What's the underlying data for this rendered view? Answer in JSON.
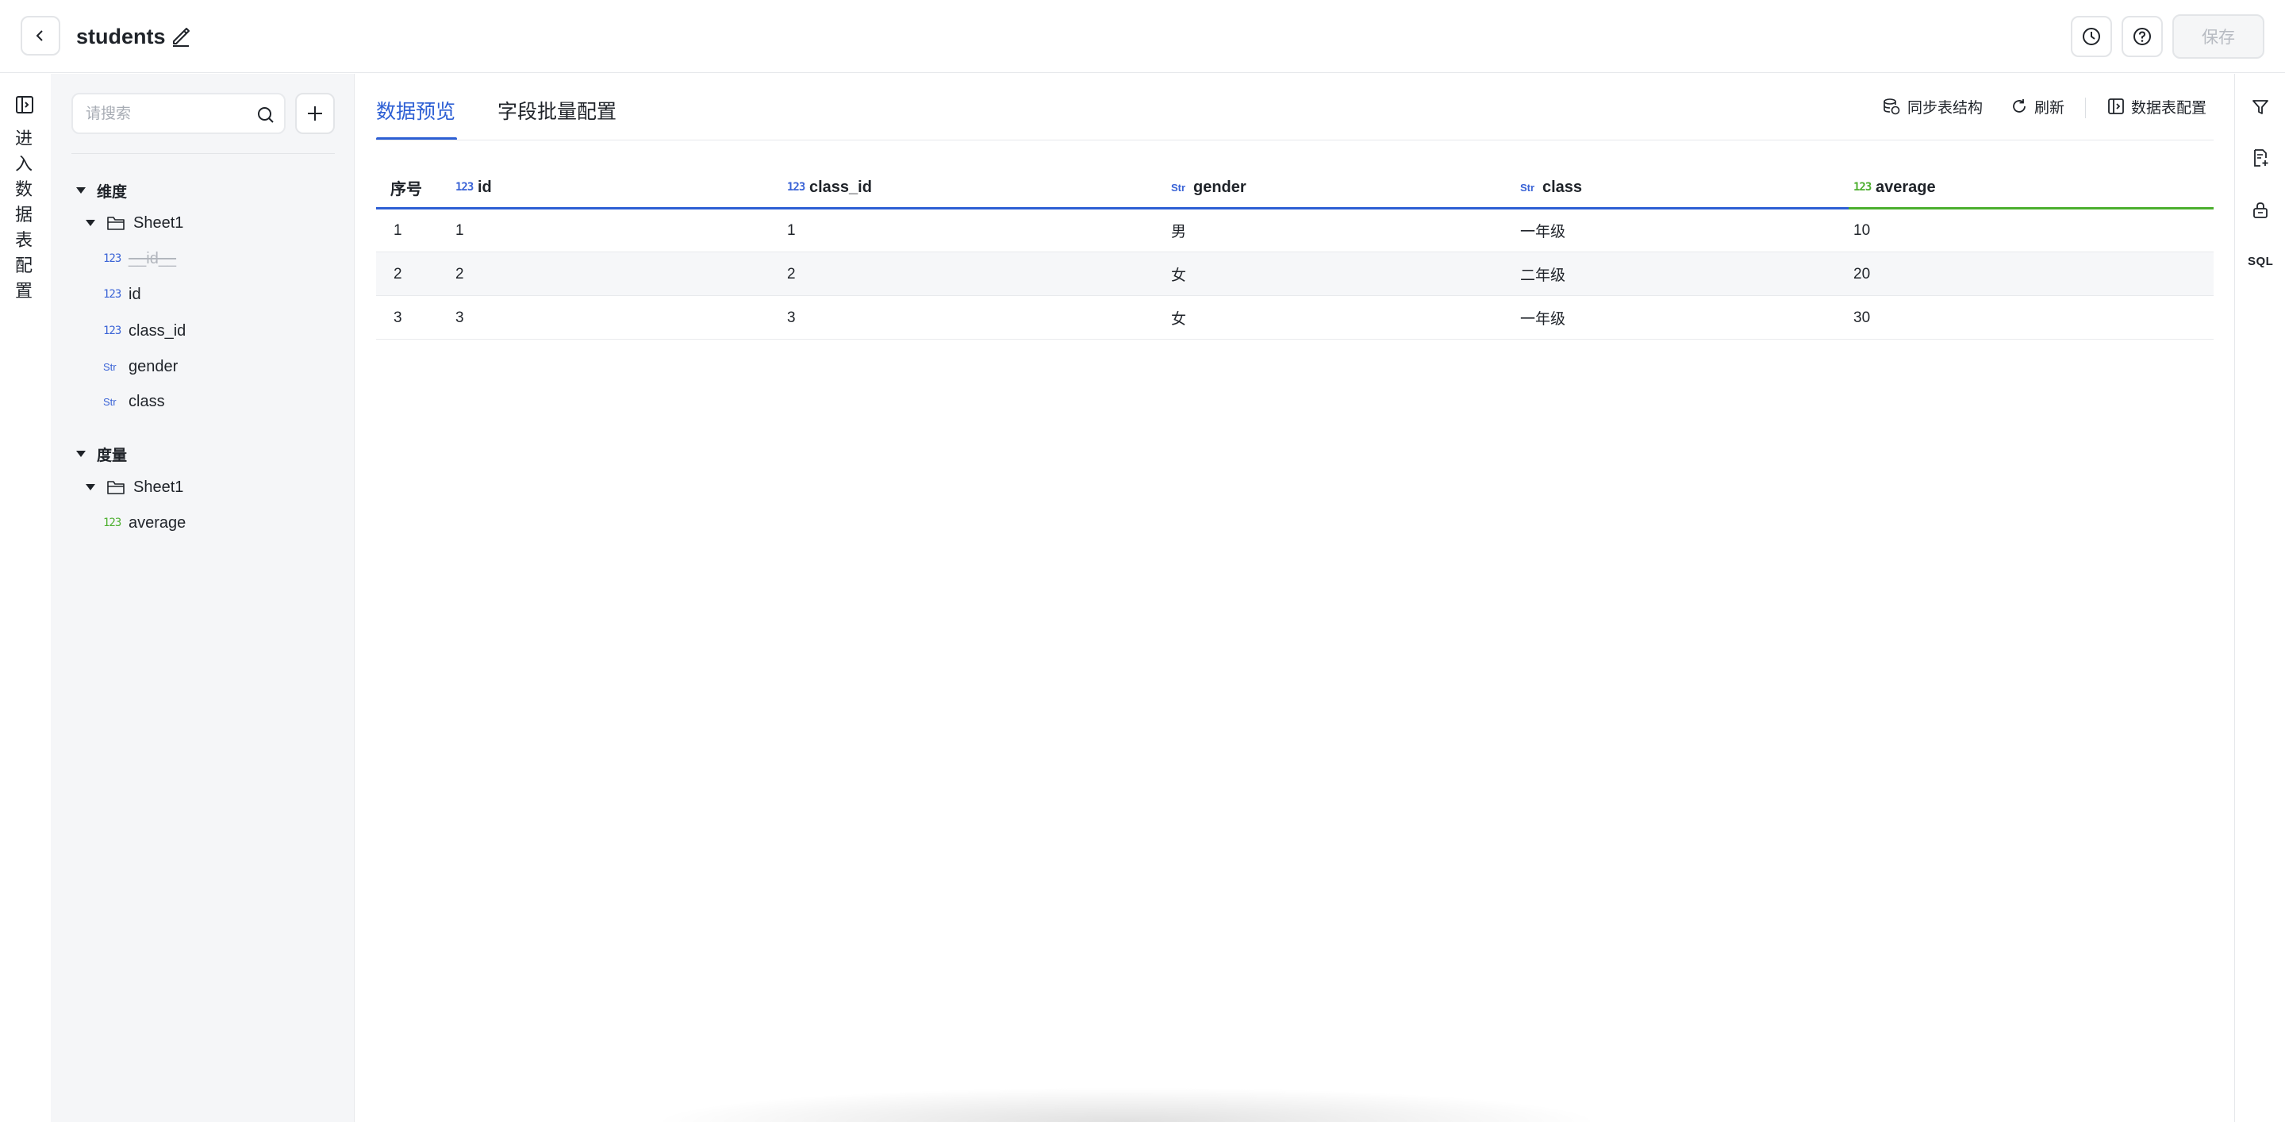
{
  "header": {
    "title": "students",
    "save_label": "保存"
  },
  "rail": {
    "label": "进入数据表配置"
  },
  "panel": {
    "search_placeholder": "请搜索",
    "dimensions": {
      "label": "维度",
      "sheet": "Sheet1",
      "fields": [
        {
          "type": "123",
          "name": "__id__",
          "disabled": true
        },
        {
          "type": "123",
          "name": "id"
        },
        {
          "type": "123",
          "name": "class_id"
        },
        {
          "type": "Str",
          "name": "gender"
        },
        {
          "type": "Str",
          "name": "class"
        }
      ]
    },
    "measures": {
      "label": "度量",
      "sheet": "Sheet1",
      "fields": [
        {
          "type": "123",
          "name": "average"
        }
      ]
    }
  },
  "main": {
    "tabs": [
      {
        "label": "数据预览",
        "active": true
      },
      {
        "label": "字段批量配置",
        "active": false
      }
    ],
    "actions": {
      "sync": "同步表结构",
      "refresh": "刷新",
      "config": "数据表配置"
    },
    "table": {
      "columns": [
        {
          "type": "",
          "name": "序号"
        },
        {
          "type": "123",
          "name": "id"
        },
        {
          "type": "123",
          "name": "class_id"
        },
        {
          "type": "Str",
          "name": "gender"
        },
        {
          "type": "Str",
          "name": "class"
        },
        {
          "type": "123",
          "name": "average"
        }
      ],
      "rows": [
        [
          "1",
          "1",
          "1",
          "男",
          "一年级",
          "10"
        ],
        [
          "2",
          "2",
          "2",
          "女",
          "二年级",
          "20"
        ],
        [
          "3",
          "3",
          "3",
          "女",
          "一年级",
          "30"
        ]
      ]
    }
  },
  "right_rail": {
    "sql_label": "SQL"
  },
  "colors": {
    "accent": "#2d5fd4",
    "dimension": "#3a63d6",
    "measure": "#4caf2e"
  },
  "icons": [
    "chevron-left-icon",
    "edit-icon",
    "history-icon",
    "help-icon",
    "panel-icon",
    "search-icon",
    "plus-icon",
    "folder-icon",
    "sync-icon",
    "refresh-icon",
    "filter-icon",
    "add-doc-icon",
    "lock-icon"
  ]
}
